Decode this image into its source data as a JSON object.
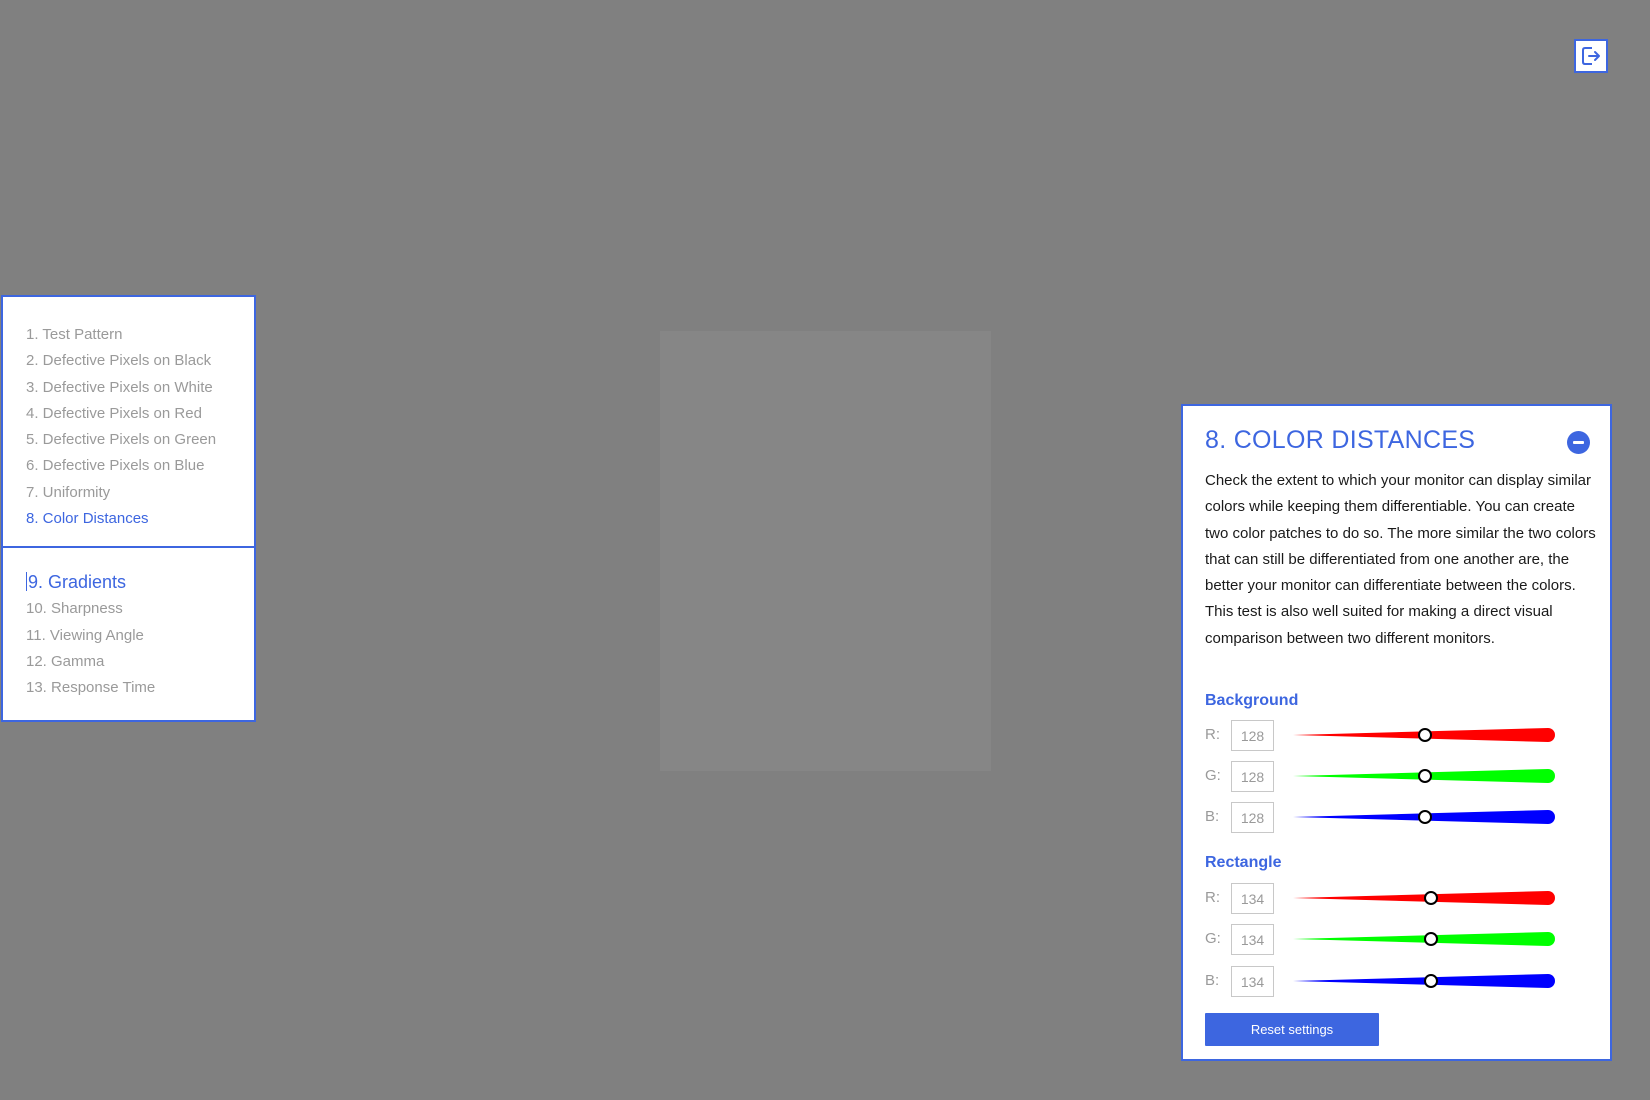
{
  "colors": {
    "accent": "#3d66e0",
    "background": "#808080",
    "rectangle": "#868686"
  },
  "exit_icon": "exit-fullscreen-icon",
  "nav": {
    "section1": [
      {
        "label": "1. Test Pattern",
        "active": false
      },
      {
        "label": "2. Defective Pixels on Black",
        "active": false
      },
      {
        "label": "3. Defective Pixels on White",
        "active": false
      },
      {
        "label": "4. Defective Pixels on Red",
        "active": false
      },
      {
        "label": "5. Defective Pixels on Green",
        "active": false
      },
      {
        "label": "6. Defective Pixels on Blue",
        "active": false
      },
      {
        "label": "7. Uniformity",
        "active": false
      },
      {
        "label": "8. Color Distances",
        "active": true
      }
    ],
    "section2": [
      {
        "label": "9. Gradients",
        "active": true
      },
      {
        "label": "10. Sharpness",
        "active": false
      },
      {
        "label": "11. Viewing Angle",
        "active": false
      },
      {
        "label": "12. Gamma",
        "active": false
      },
      {
        "label": "13. Response Time",
        "active": false
      }
    ]
  },
  "panel": {
    "title": "8. COLOR DISTANCES",
    "collapse_icon": "minus-circle-icon",
    "description": "Check the extent to which your monitor can display similar colors while keeping them differentiable. You can create two color patches to do so. The more similar the two colors that can still be differentiated from one another are, the better your monitor can differentiate between the colors. This test is also well suited for making a direct visual comparison between two different monitors.",
    "background_label": "Background",
    "rectangle_label": "Rectangle",
    "background": {
      "r": "128",
      "g": "128",
      "b": "128"
    },
    "rectangle": {
      "r": "134",
      "g": "134",
      "b": "134"
    },
    "channel_labels": {
      "r": "R:",
      "g": "G:",
      "b": "B:"
    },
    "slider_colors": {
      "r": "#ff0000",
      "g": "#00ff00",
      "b": "#0000ff"
    },
    "reset_label": "Reset settings"
  }
}
